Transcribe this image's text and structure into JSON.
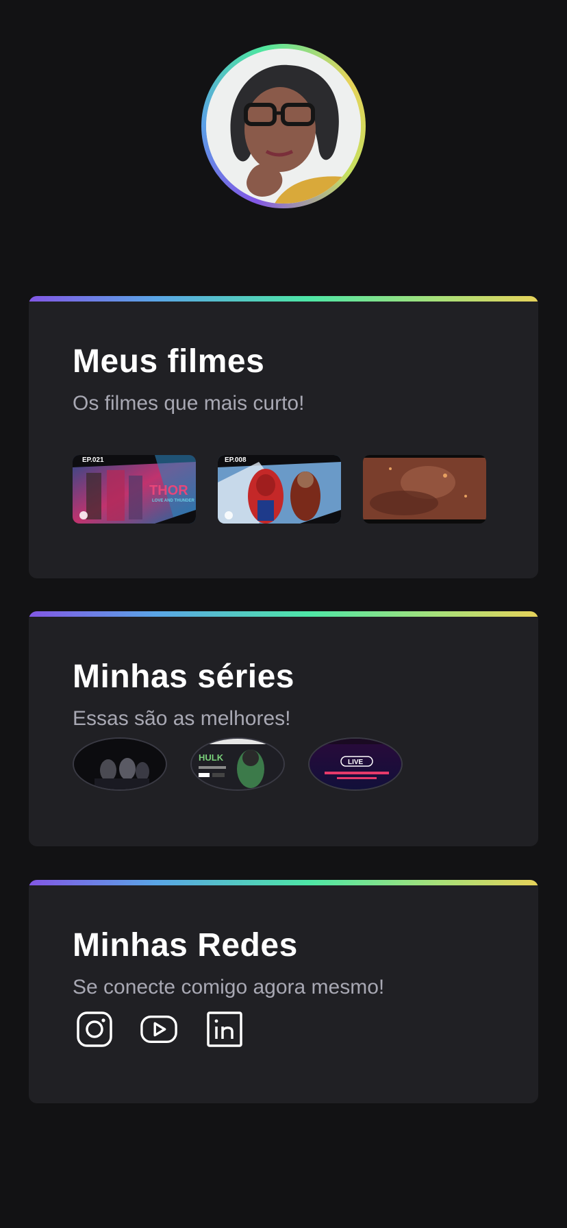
{
  "profile": {
    "avatar_alt": "profile photo"
  },
  "movies": {
    "title": "Meus filmes",
    "subtitle": "Os filmes que mais curto!",
    "items": [
      {
        "badge": "EP.021",
        "logo": "THOR",
        "logo_sub": "LOVE AND THUNDER"
      },
      {
        "badge": "EP.008",
        "logo": "",
        "logo_sub": ""
      },
      {
        "badge": "",
        "logo": "",
        "logo_sub": ""
      }
    ]
  },
  "series": {
    "title": "Minhas séries",
    "subtitle": "Essas são as melhores!",
    "items": [
      {
        "label": ""
      },
      {
        "label": "HULK"
      },
      {
        "label": "LIVE"
      }
    ]
  },
  "social": {
    "title": "Minhas Redes",
    "subtitle": "Se conecte comigo agora mesmo!",
    "links": [
      {
        "icon": "instagram-icon"
      },
      {
        "icon": "youtube-icon"
      },
      {
        "icon": "linkedin-icon"
      }
    ]
  },
  "colors": {
    "background": "#121214",
    "card": "#202024",
    "title": "#ffffff",
    "subtitle": "#a8a8b3",
    "gradient": [
      "#8257e5",
      "#4ee6a6",
      "#e6d25a"
    ]
  }
}
